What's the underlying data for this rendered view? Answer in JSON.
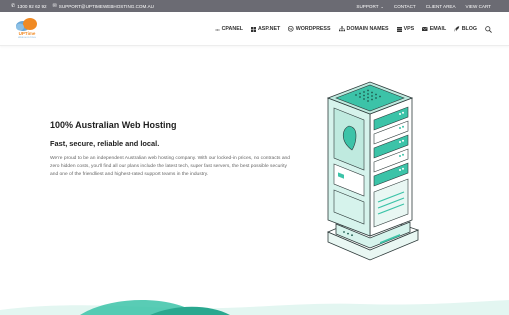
{
  "topbar": {
    "phone": "1300 92 62 92",
    "email": "SUPPORT@UPTIMEWEBHOSTING.COM.AU",
    "links": [
      {
        "label": "SUPPORT",
        "has_dropdown": true
      },
      {
        "label": "CONTACT"
      },
      {
        "label": "CLIENT AREA"
      },
      {
        "label": "VIEW CART"
      }
    ],
    "background": "#6b6b73"
  },
  "logo": {
    "text": "UPTime",
    "subtext": "WEB HOSTING"
  },
  "nav": {
    "items": [
      {
        "label": "CPANEL",
        "icon": "cpanel-icon"
      },
      {
        "label": "ASP.NET",
        "icon": "windows-icon"
      },
      {
        "label": "WORDPRESS",
        "icon": "wordpress-icon"
      },
      {
        "label": "DOMAIN NAMES",
        "icon": "sitemap-icon"
      },
      {
        "label": "VPS",
        "icon": "server-icon"
      },
      {
        "label": "EMAIL",
        "icon": "envelope-icon"
      },
      {
        "label": "BLOG",
        "icon": "rocket-icon"
      }
    ],
    "search_icon": "search-icon"
  },
  "hero": {
    "title": "100% Australian Web Hosting",
    "subtitle": "Fast, secure, reliable and local.",
    "paragraph": "We're proud to be an independent Australian web hosting company. With our locked-in prices, no contracts and zero hidden costs, you'll find all our plans include the latest tech, super fast servers, the best possible security and one of the friendliest and highest-rated support teams in the industry."
  },
  "colors": {
    "accent_teal": "#3cc3a8",
    "teal_light": "#d6f3ec",
    "logo_orange": "#f08a24",
    "logo_blue": "#6ba7d6"
  }
}
